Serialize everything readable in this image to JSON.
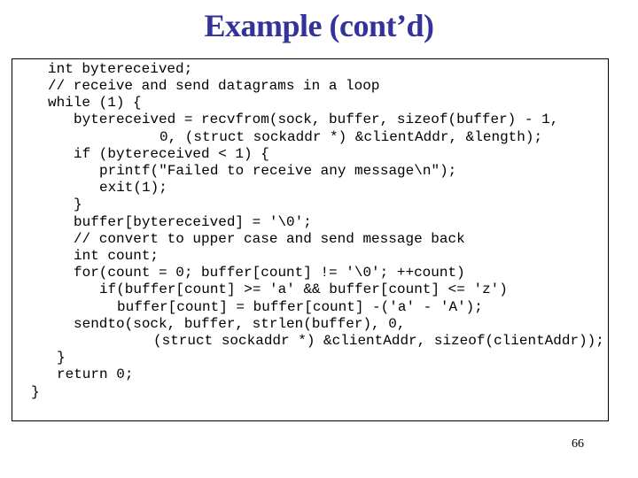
{
  "slide": {
    "title": "Example (cont’d)",
    "page_number": "66",
    "colors": {
      "title": "#333399",
      "text": "#000000",
      "border": "#000000"
    }
  },
  "code": {
    "lines": [
      "int bytereceived;",
      "// receive and send datagrams in a loop",
      "while (1) {",
      "bytereceived = recvfrom(sock, buffer, sizeof(buffer) - 1,",
      "0, (struct sockaddr *) &clientAddr, &length);",
      "if (bytereceived < 1) {",
      "printf(\"Failed to receive any message\\n\");",
      "exit(1);",
      "}",
      "buffer[bytereceived] = '\\0';",
      "// convert to upper case and send message back",
      "int count;",
      "for(count = 0; buffer[count] != '\\0'; ++count)",
      "if(buffer[count] >= 'a' && buffer[count] <= 'z')",
      "buffer[count] = buffer[count] -('a' - 'A');",
      "sendto(sock, buffer, strlen(buffer), 0,",
      "(struct sockaddr *) &clientAddr, sizeof(clientAddr));",
      "}",
      "return 0;",
      "}"
    ]
  }
}
